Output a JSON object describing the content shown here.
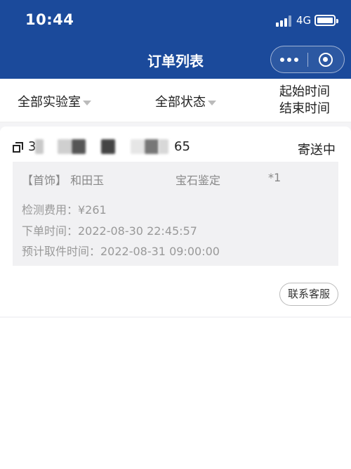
{
  "status_bar": {
    "time": "10:44",
    "network": "4G"
  },
  "nav": {
    "title": "订单列表"
  },
  "filters": {
    "lab": "全部实验室",
    "status": "全部状态",
    "start_time": "起始时间",
    "end_time": "结束时间"
  },
  "order": {
    "number_prefix": "3",
    "number_suffix": "65",
    "status": "寄送中",
    "item_name": "【首饰】 和田玉",
    "service": "宝石鉴定",
    "quantity": "*1",
    "fee": "检测费用：¥261",
    "order_time": "下单时间：2022-08-30 22:45:57",
    "pickup_time": "预计取件时间：2022-08-31 09:00:00",
    "contact_button": "联系客服"
  },
  "colors": {
    "header": "#1b4a9b",
    "detail_bg": "#f1f1f3"
  },
  "icons": [
    "signal-icon",
    "battery-icon",
    "more-icon",
    "target-icon",
    "copy-icon",
    "caret-down-icon"
  ]
}
